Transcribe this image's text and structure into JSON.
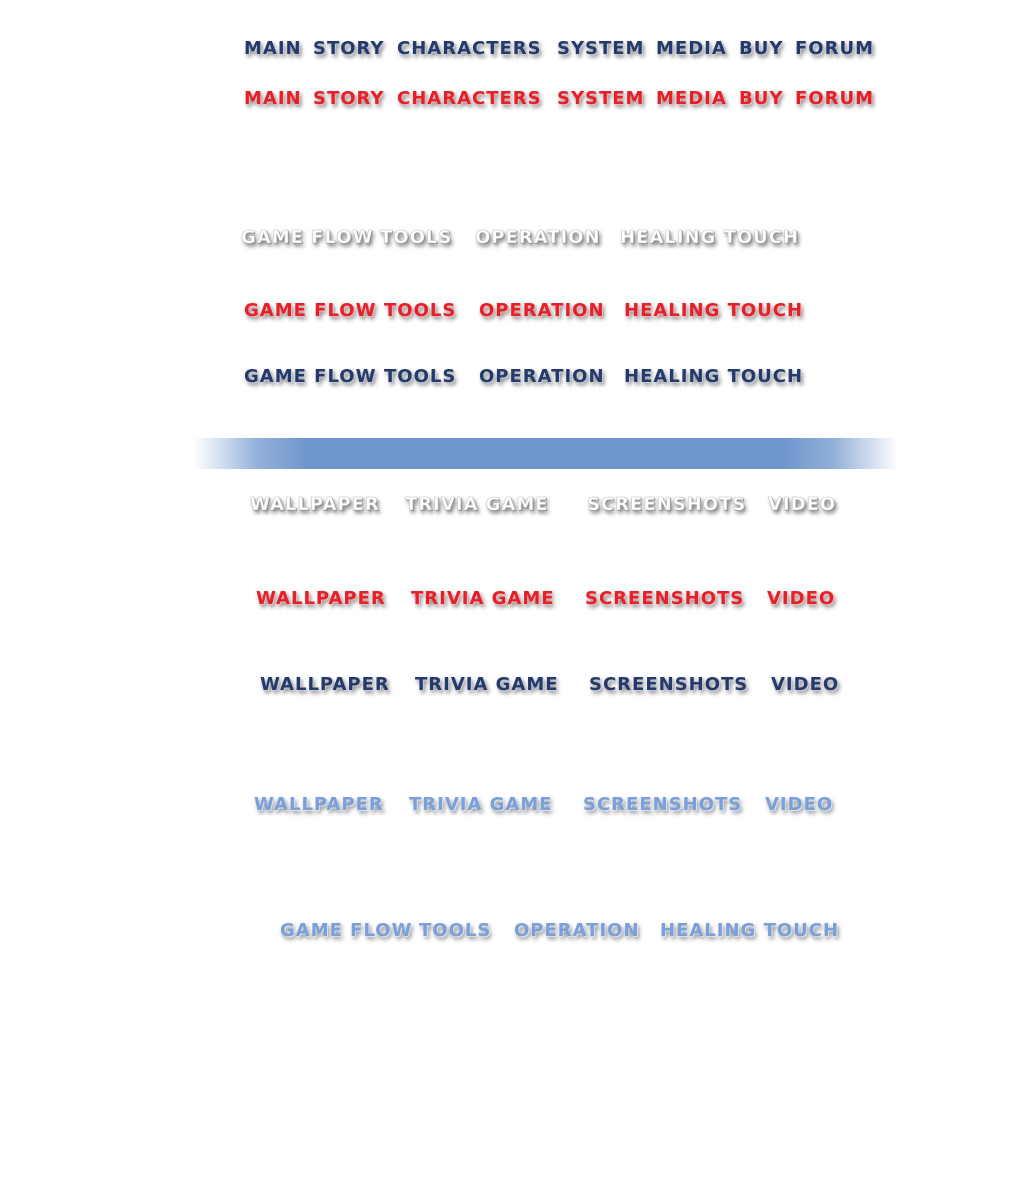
{
  "main_nav": {
    "items": [
      "MAIN",
      "STORY",
      "CHARACTERS",
      "SYSTEM",
      "MEDIA",
      "BUY",
      "FORUM"
    ]
  },
  "system_nav": {
    "items": [
      "GAME FLOW",
      "TOOLS",
      "OPERATION",
      "HEALING TOUCH"
    ]
  },
  "media_nav": {
    "items": [
      "WALLPAPER",
      "TRIVIA GAME",
      "SCREENSHOTS",
      "VIDEO"
    ]
  },
  "colors": {
    "navy": "#253a6b",
    "red": "#e4202a",
    "white": "#ffffff",
    "blue": "#7b9fd6",
    "divider": "#6f97cd"
  }
}
